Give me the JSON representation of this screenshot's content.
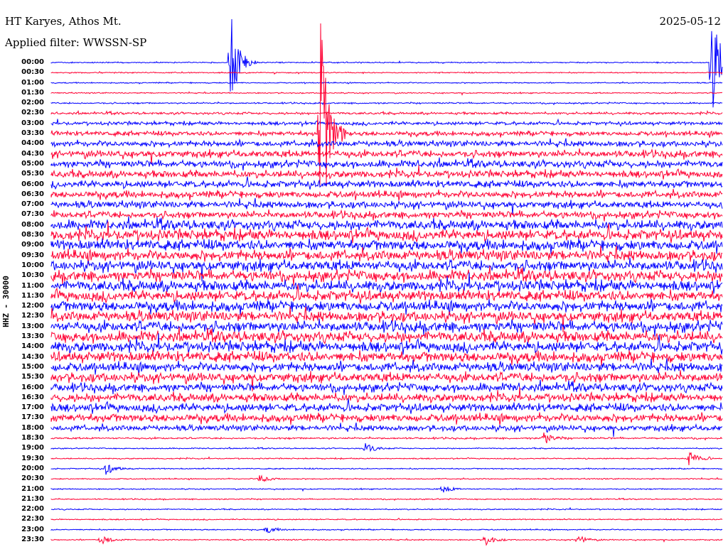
{
  "header": {
    "station": "HT Karyes, Athos Mt.",
    "filter": "Applied filter: WWSSN-SP",
    "date": "2025-05-12"
  },
  "chart_data": {
    "type": "line",
    "title": "HT Karyes, Athos Mt.",
    "subtitle": "Applied filter: WWSSN-SP",
    "ylabel": "HHZ - 30000",
    "date": "2025-05-12",
    "colors": [
      "#0000ff",
      "#ff0033"
    ],
    "rows": [
      "00:00",
      "00:30",
      "01:00",
      "01:30",
      "02:00",
      "02:30",
      "03:00",
      "03:30",
      "04:00",
      "04:30",
      "05:00",
      "05:30",
      "06:00",
      "06:30",
      "07:00",
      "07:30",
      "08:00",
      "08:30",
      "09:00",
      "09:30",
      "10:00",
      "10:30",
      "11:00",
      "11:30",
      "12:00",
      "12:30",
      "13:00",
      "13:30",
      "14:00",
      "14:30",
      "15:00",
      "15:30",
      "16:00",
      "16:30",
      "17:00",
      "17:30",
      "18:00",
      "18:30",
      "19:00",
      "19:30",
      "20:00",
      "20:30",
      "21:00",
      "21:30",
      "22:00",
      "22:30",
      "23:00",
      "23:30"
    ],
    "relative_noise_level": [
      1,
      1,
      1,
      1,
      1.3,
      2,
      3,
      4,
      5,
      6,
      6,
      6,
      6,
      6,
      6,
      6,
      8,
      9,
      9,
      9,
      9,
      9,
      9,
      9,
      9,
      9,
      9,
      9,
      9,
      9,
      8,
      8,
      7,
      7,
      7,
      7,
      5,
      1.5,
      1,
      1,
      1,
      1,
      1,
      1,
      1,
      1,
      1,
      1
    ],
    "events": [
      {
        "row": 0,
        "minute": 8,
        "amp": 75
      },
      {
        "row": 0,
        "minute": 29.5,
        "amp": 90
      },
      {
        "row": 7,
        "minute": 12,
        "amp": 190
      },
      {
        "row": 37,
        "minute": 22,
        "amp": 10
      },
      {
        "row": 38,
        "minute": 14,
        "amp": 9
      },
      {
        "row": 39,
        "minute": 28.5,
        "amp": 12
      },
      {
        "row": 40,
        "minute": 2.4,
        "amp": 10
      },
      {
        "row": 41,
        "minute": 9.3,
        "amp": 8
      },
      {
        "row": 42,
        "minute": 17.5,
        "amp": 6
      },
      {
        "row": 46,
        "minute": 9.6,
        "amp": 6
      },
      {
        "row": 47,
        "minute": 2.2,
        "amp": 9
      },
      {
        "row": 47,
        "minute": 19.4,
        "amp": 9
      },
      {
        "row": 47,
        "minute": 23.5,
        "amp": 8
      }
    ]
  }
}
